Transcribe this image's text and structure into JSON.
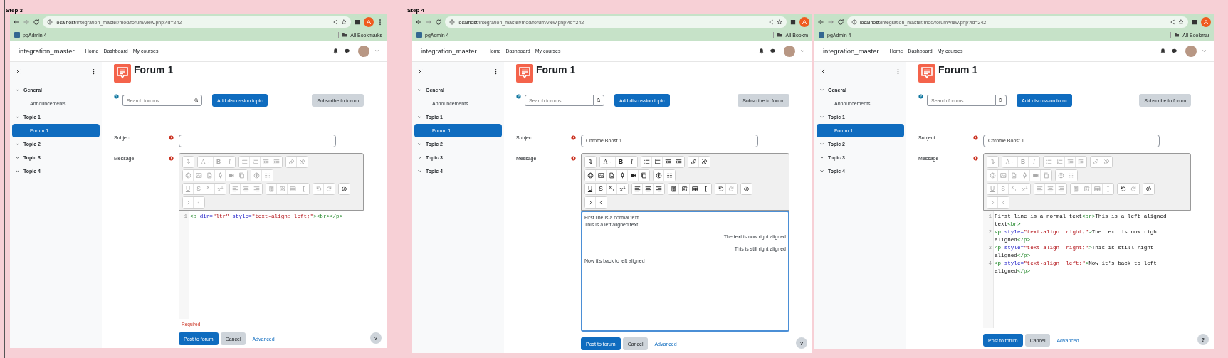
{
  "panels": [
    {
      "step": "Step 3",
      "browser": {
        "host": "localhost",
        "path": "/integration_master/mod/forum/view.php?id=242",
        "profile": "A",
        "bookmark": "pgAdmin 4",
        "all_bookmarks": "All Bookmarks",
        "menu": true
      },
      "site": {
        "name": "integration_master",
        "links": [
          "Home",
          "Dashboard",
          "My courses"
        ]
      },
      "sidebar": [
        {
          "label": "General",
          "expanded": true,
          "selected": false,
          "children": [
            {
              "label": "Announcements",
              "selected": false
            }
          ]
        },
        {
          "label": "Topic 1",
          "expanded": true,
          "selected": false,
          "children": [
            {
              "label": "Forum 1",
              "selected": true
            }
          ]
        },
        {
          "label": "Topic 2",
          "expanded": true,
          "selected": false
        },
        {
          "label": "Topic 3",
          "expanded": true,
          "selected": false
        },
        {
          "label": "Topic 4",
          "expanded": true,
          "selected": false
        }
      ],
      "title": "Forum 1",
      "search_placeholder": "Search forums",
      "actions": [
        "Add discussion topic",
        "Subscribe to forum"
      ],
      "subject_label": "Subject",
      "message_label": "Message",
      "toolbar": [
        [
          [
            {
              "disabled": true
            }
          ],
          [
            {
              "label": "A",
              "disabled": true
            },
            {
              "label": "B",
              "disabled": true
            },
            {
              "label": "I",
              "disabled": true
            }
          ],
          [
            {
              "disabled": true
            },
            {
              "disabled": true
            },
            {
              "disabled": true
            },
            {
              "disabled": true
            }
          ],
          [
            {
              "disabled": true
            },
            {
              "disabled": true
            }
          ]
        ],
        [
          [
            {
              "disabled": true
            },
            {
              "disabled": true
            },
            {
              "disabled": true
            },
            {
              "disabled": true
            },
            {
              "disabled": true
            },
            {
              "disabled": true
            }
          ],
          [
            {
              "disabled": true
            },
            {
              "disabled": true
            }
          ]
        ],
        [
          [
            {
              "label": "U",
              "disabled": true
            },
            {
              "label": "S",
              "disabled": true
            },
            {
              "label": "X$_{1}$",
              "disabled": true
            },
            {
              "label": "X$^{1}$",
              "disabled": true
            }
          ],
          [
            {
              "disabled": true
            },
            {
              "disabled": true
            },
            {
              "disabled": true
            }
          ],
          [
            {
              "disabled": true
            },
            {
              "disabled": true
            },
            {
              "disabled": true
            },
            {
              "disabled": true
            }
          ],
          [
            {
              "disabled": true
            },
            {
              "disabled": true
            }
          ],
          [
            {
              "disabled": false
            }
          ]
        ],
        [
          [
            {
              "disabled": true
            },
            {
              "disabled": true
            }
          ]
        ]
      ],
      "editor": {
        "kind": "code",
        "lines": [
          {
            "number": "1",
            "tokens": [
              {
                "kind": "tag",
                "text": "<p"
              },
              {
                "kind": "attr",
                "text": " dir="
              },
              {
                "kind": "value",
                "text": "\"ltr\""
              },
              {
                "kind": "attr",
                "text": " style="
              },
              {
                "kind": "value",
                "text": "\"text-align: left;\""
              },
              {
                "kind": "tag",
                "text": "><br></p>"
              }
            ]
          }
        ]
      },
      "required_note": "- Required",
      "buttons": [
        "Post to forum",
        "Cancel"
      ],
      "advanced": "Advanced",
      "help": "?"
    },
    {
      "step": "Step 4",
      "browser": {
        "host": "localhost",
        "path": "/integration_master/mod/forum/view.php?id=242",
        "profile": "A",
        "bookmark": "pgAdmin 4",
        "all_bookmarks": "All Bookm",
        "menu": false
      },
      "site": {
        "name": "integration_master",
        "links": [
          "Home",
          "Dashboard",
          "My courses"
        ]
      },
      "sidebar": [
        {
          "label": "General",
          "expanded": true,
          "selected": false,
          "children": [
            {
              "label": "Announcements",
              "selected": false
            }
          ]
        },
        {
          "label": "Topic 1",
          "expanded": true,
          "selected": false,
          "children": [
            {
              "label": "Forum 1",
              "selected": true
            }
          ]
        },
        {
          "label": "Topic 2",
          "expanded": true,
          "selected": false
        },
        {
          "label": "Topic 3",
          "expanded": true,
          "selected": false
        },
        {
          "label": "Topic 4",
          "expanded": true,
          "selected": false
        }
      ],
      "title": "Forum 1",
      "search_placeholder": "Search forums",
      "actions": [
        "Add discussion topic",
        "Subscribe to forum"
      ],
      "subject_label": "Subject",
      "subject_value": "Chrome Boost 1",
      "message_label": "Message",
      "toolbar": [
        [
          [
            {
              "disabled": false
            }
          ],
          [
            {
              "label": "A",
              "disabled": false
            },
            {
              "label": "B",
              "disabled": false
            },
            {
              "label": "I",
              "disabled": false
            }
          ],
          [
            {
              "disabled": false
            },
            {
              "disabled": false
            },
            {
              "disabled": false
            },
            {
              "disabled": false
            }
          ],
          [
            {
              "disabled": false
            },
            {
              "disabled": false
            }
          ]
        ],
        [
          [
            {
              "disabled": false
            },
            {
              "disabled": false
            },
            {
              "disabled": false
            },
            {
              "disabled": false
            },
            {
              "disabled": false
            },
            {
              "disabled": false
            }
          ],
          [
            {
              "disabled": false
            },
            {
              "disabled": false
            }
          ]
        ],
        [
          [
            {
              "label": "U",
              "disabled": false
            },
            {
              "label": "S",
              "disabled": false
            },
            {
              "label": "X$_{1}$",
              "disabled": false
            },
            {
              "label": "X$^{1}$",
              "disabled": false
            }
          ],
          [
            {
              "disabled": false
            },
            {
              "disabled": false
            },
            {
              "disabled": false
            }
          ],
          [
            {
              "disabled": false
            },
            {
              "disabled": false
            },
            {
              "disabled": false
            },
            {
              "disabled": false
            }
          ],
          [
            {
              "disabled": false
            },
            {
              "disabled": true
            }
          ],
          [
            {
              "disabled": false
            }
          ]
        ],
        [
          [
            {
              "disabled": false
            },
            {
              "disabled": false
            }
          ]
        ]
      ],
      "editor": {
        "kind": "rich",
        "focused": true,
        "paragraphs": [
          {
            "right_aligned": false,
            "lines": [
              "First line is a normal text",
              "This is a left aligned text"
            ]
          },
          {
            "right_aligned": true,
            "lines": [
              "The text is now right aligned"
            ]
          },
          {
            "right_aligned": true,
            "lines": [
              "This is still right aligned"
            ]
          },
          {
            "right_aligned": false,
            "lines": [
              "Now it's back to left aligned"
            ]
          }
        ]
      },
      "buttons": [
        "Post to forum",
        "Cancel"
      ],
      "advanced": "Advanced",
      "help": "?"
    },
    {
      "browser": {
        "host": "localhost",
        "path": "/integration_master/mod/forum/view.php?id=242",
        "profile": "A",
        "bookmark": "pgAdmin 4",
        "all_bookmarks": "All Bookmar",
        "menu": false
      },
      "site": {
        "name": "integration_master",
        "links": [
          "Home",
          "Dashboard",
          "My courses"
        ]
      },
      "sidebar": [
        {
          "label": "General",
          "expanded": true,
          "selected": false,
          "children": [
            {
              "label": "Announcements",
              "selected": false
            }
          ]
        },
        {
          "label": "Topic 1",
          "expanded": true,
          "selected": false,
          "children": [
            {
              "label": "Forum 1",
              "selected": true
            }
          ]
        },
        {
          "label": "Topic 2",
          "expanded": true,
          "selected": false
        },
        {
          "label": "Topic 3",
          "expanded": true,
          "selected": false
        },
        {
          "label": "Topic 4",
          "expanded": true,
          "selected": false
        }
      ],
      "title": "Forum 1",
      "search_placeholder": "Search forums",
      "actions": [
        "Add discussion topic",
        "Subscribe to forum"
      ],
      "subject_label": "Subject",
      "subject_value": "Chrome Boost 1",
      "message_label": "Message",
      "toolbar": [
        [
          [
            {
              "disabled": true
            }
          ],
          [
            {
              "label": "A",
              "disabled": true
            },
            {
              "label": "B",
              "disabled": true
            },
            {
              "label": "I",
              "disabled": true
            }
          ],
          [
            {
              "disabled": true
            },
            {
              "disabled": true
            },
            {
              "disabled": true
            },
            {
              "disabled": true
            }
          ],
          [
            {
              "disabled": true
            },
            {
              "disabled": true
            }
          ]
        ],
        [
          [
            {
              "disabled": true
            },
            {
              "disabled": true
            },
            {
              "disabled": true
            },
            {
              "disabled": true
            },
            {
              "disabled": true
            },
            {
              "disabled": true
            }
          ],
          [
            {
              "disabled": true
            },
            {
              "disabled": true
            }
          ]
        ],
        [
          [
            {
              "label": "U",
              "disabled": true
            },
            {
              "label": "S",
              "disabled": true
            },
            {
              "label": "X$_{1}$",
              "disabled": true
            },
            {
              "label": "X$^{1}$",
              "disabled": true
            }
          ],
          [
            {
              "disabled": true
            },
            {
              "disabled": true
            },
            {
              "disabled": true
            }
          ],
          [
            {
              "disabled": true
            },
            {
              "disabled": true
            },
            {
              "disabled": true
            },
            {
              "disabled": true
            }
          ],
          [
            {
              "disabled": false
            },
            {
              "disabled": true
            }
          ],
          [
            {
              "disabled": false
            }
          ]
        ],
        [
          [
            {
              "disabled": true
            },
            {
              "disabled": true
            }
          ]
        ]
      ],
      "editor": {
        "kind": "code",
        "lines": [
          {
            "number": "1",
            "tokens": [
              {
                "kind": "text",
                "text": "First line is a normal text"
              },
              {
                "kind": "tag",
                "text": "<br>"
              },
              {
                "kind": "text",
                "text": "This is a left aligned text"
              },
              {
                "kind": "tag",
                "text": "<br>"
              }
            ]
          },
          {
            "number": "2",
            "tokens": [
              {
                "kind": "tag",
                "text": "<p"
              },
              {
                "kind": "attr",
                "text": " style="
              },
              {
                "kind": "value",
                "text": "\"text-align: right;\""
              },
              {
                "kind": "tag",
                "text": ">"
              },
              {
                "kind": "text",
                "text": "The text is now right aligned"
              },
              {
                "kind": "tag",
                "text": "</p>"
              }
            ]
          },
          {
            "number": "3",
            "tokens": [
              {
                "kind": "tag",
                "text": "<p"
              },
              {
                "kind": "attr",
                "text": " style="
              },
              {
                "kind": "value",
                "text": "\"text-align: right;\""
              },
              {
                "kind": "tag",
                "text": ">"
              },
              {
                "kind": "text",
                "text": "This is still right aligned"
              },
              {
                "kind": "tag",
                "text": "</p>"
              }
            ]
          },
          {
            "number": "4",
            "tokens": [
              {
                "kind": "tag",
                "text": "<p"
              },
              {
                "kind": "attr",
                "text": " style="
              },
              {
                "kind": "value",
                "text": "\"text-align: left;\""
              },
              {
                "kind": "tag",
                "text": ">"
              },
              {
                "kind": "text",
                "text": "Now it's back to left aligned"
              },
              {
                "kind": "tag",
                "text": "</p>"
              }
            ]
          }
        ]
      },
      "buttons": [
        "Post to forum",
        "Cancel"
      ],
      "advanced": "Advanced",
      "help": "?"
    }
  ]
}
